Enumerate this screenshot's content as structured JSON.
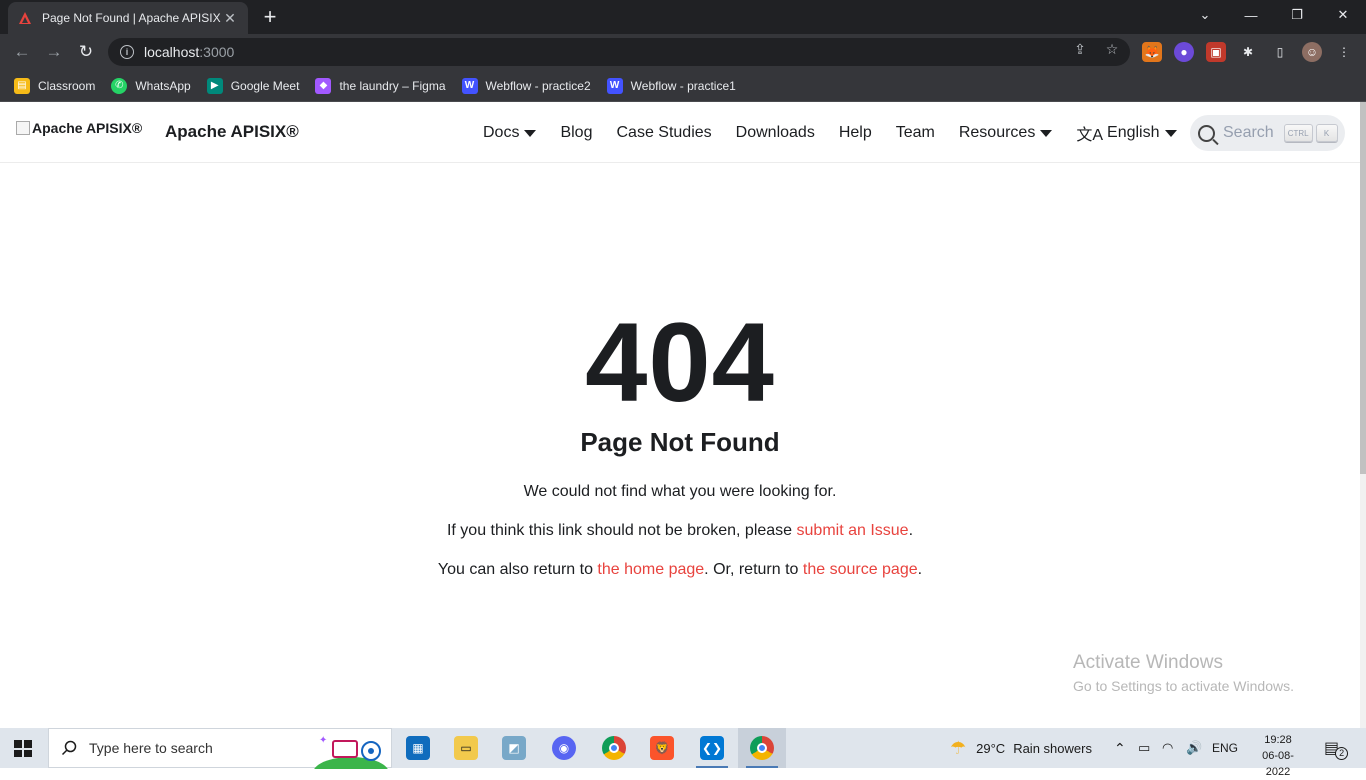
{
  "browser": {
    "tab_title": "Page Not Found | Apache APISIX",
    "tab_close": "✕",
    "new_tab": "+",
    "window_controls": {
      "minimize": "—",
      "restore": "❐",
      "close": "✕",
      "chevron": "⌄"
    },
    "url_host": "localhost",
    "url_port": ":3000",
    "nav": {
      "back": "←",
      "forward": "→",
      "reload": "↻"
    }
  },
  "bookmarks": [
    {
      "label": "Classroom",
      "icon": "classroom-icon",
      "color": "#f6bb18"
    },
    {
      "label": "WhatsApp",
      "icon": "whatsapp-icon",
      "color": "#25d366"
    },
    {
      "label": "Google Meet",
      "icon": "google-meet-icon",
      "color": "#00897b"
    },
    {
      "label": "the laundry – Figma",
      "icon": "figma-icon",
      "color": "#a259ff"
    },
    {
      "label": "Webflow - practice2",
      "icon": "webflow-icon",
      "color": "#4353ff"
    },
    {
      "label": "Webflow - practice1",
      "icon": "webflow-icon",
      "color": "#4353ff"
    }
  ],
  "site": {
    "logo_alt": "Apache APISIX®",
    "brand": "Apache APISIX®",
    "nav": {
      "docs": "Docs",
      "blog": "Blog",
      "case_studies": "Case Studies",
      "downloads": "Downloads",
      "help": "Help",
      "team": "Team",
      "resources": "Resources",
      "language": "English",
      "language_icon": "文A"
    },
    "search": {
      "placeholder": "Search",
      "key1": "CTRL",
      "key2": "K"
    }
  },
  "notfound": {
    "code": "404",
    "title": "Page Not Found",
    "line1": "We could not find what you were looking for.",
    "line2_pre": "If you think this link should not be broken, please ",
    "line2_link": "submit an Issue",
    "line2_post": ".",
    "line3_pre": "You can also return to ",
    "line3_link1": "the home page",
    "line3_mid": ". Or, return to ",
    "line3_link2": "the source page",
    "line3_post": "."
  },
  "watermark": {
    "line1": "Activate Windows",
    "line2": "Go to Settings to activate Windows."
  },
  "taskbar": {
    "search_placeholder": "Type here to search",
    "weather_temp": "29°C",
    "weather_desc": "Rain showers",
    "lang": "ENG",
    "time": "19:28",
    "date": "06-08-2022",
    "notifications": "2"
  },
  "colors": {
    "accent_link": "#e8433e",
    "text": "#1c1e21"
  }
}
